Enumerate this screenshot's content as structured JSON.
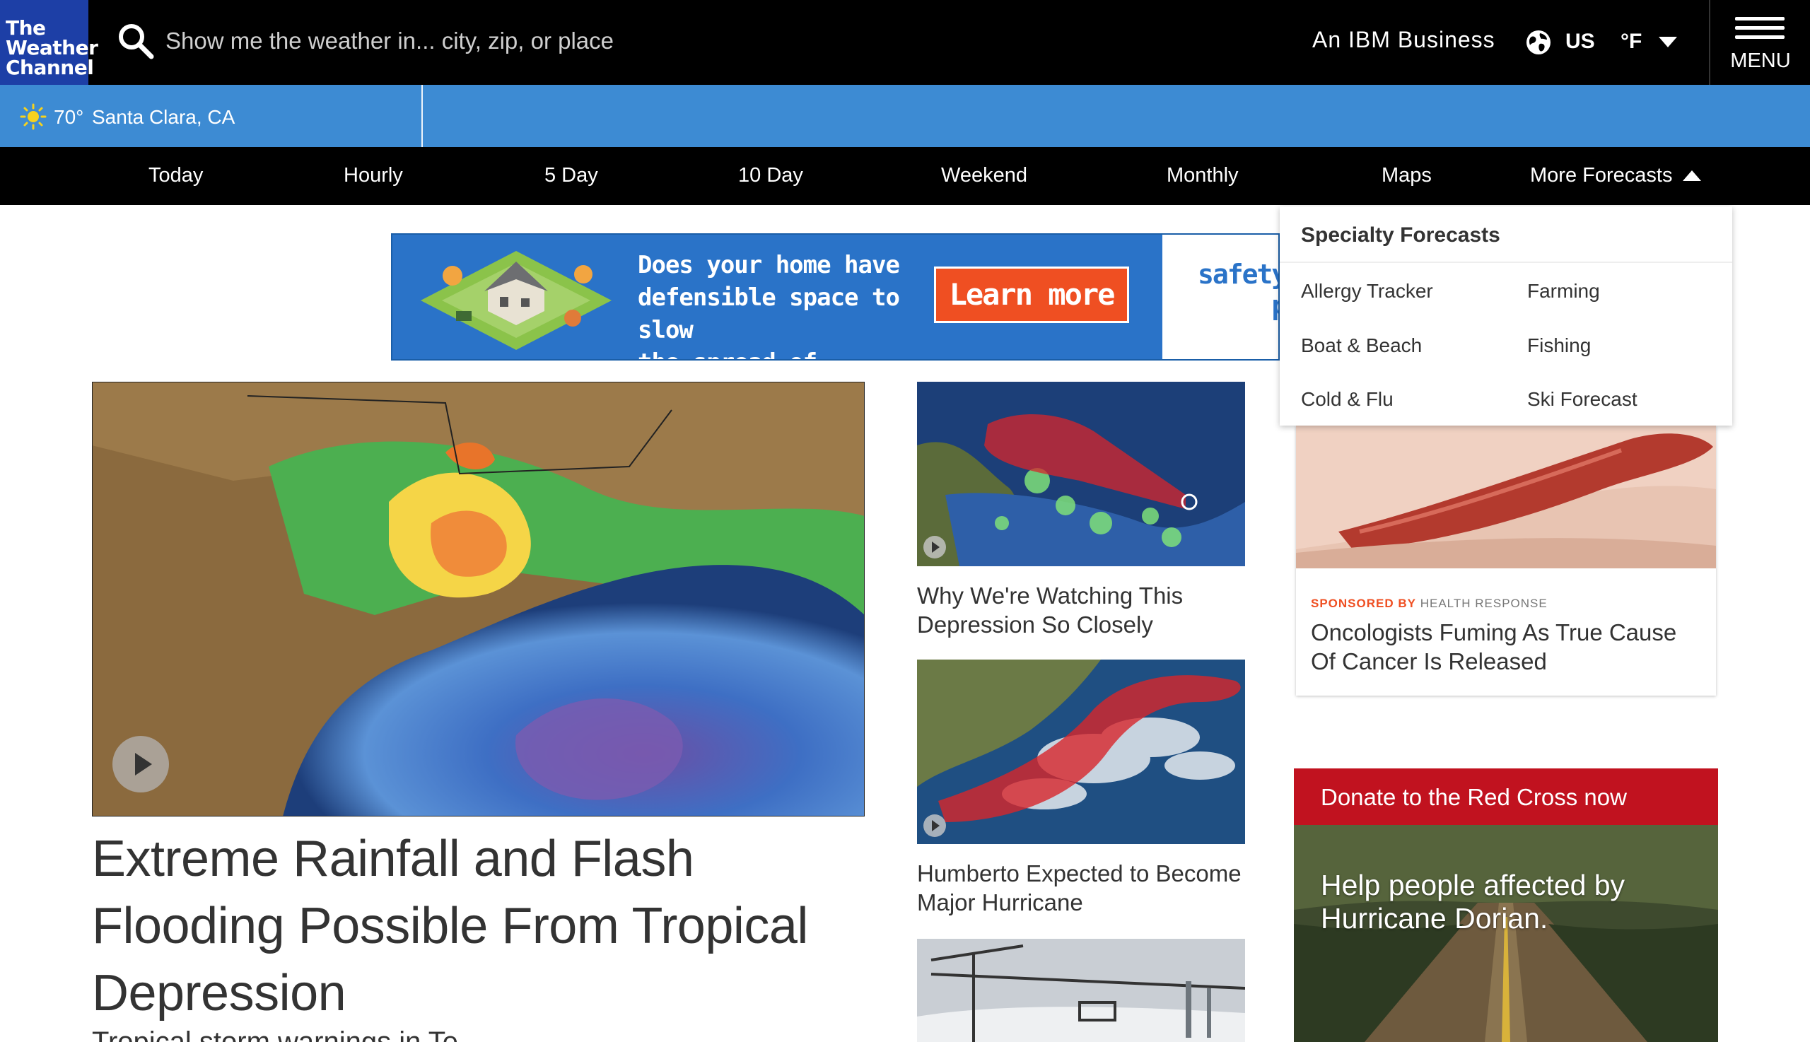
{
  "header": {
    "logo": [
      "The",
      "Weather",
      "Channel"
    ],
    "search_placeholder": "Show me the weather in... city, zip, or place",
    "ibm": "An IBM Business",
    "region": "US",
    "unit": "°F",
    "menu_label": "MENU"
  },
  "location": {
    "icon": "sun-icon",
    "temp": "70°",
    "name": "Santa Clara, CA"
  },
  "nav": {
    "items": [
      "Today",
      "Hourly",
      "5 Day",
      "10 Day",
      "Weekend",
      "Monthly",
      "Maps",
      "More Forecasts"
    ]
  },
  "ad": {
    "headline": [
      "Does your home have",
      "defensible space to slow",
      "the spread of wildfires?"
    ],
    "cta": "Learn more",
    "brand": [
      "safetyac",
      "pge"
    ]
  },
  "hero": {
    "title": "Extreme Rainfall and Flash Flooding Possible From Tropical Depression",
    "subtitle": "Tropical storm warnings in Te"
  },
  "cards": [
    {
      "title": "Why We're Watching This Depression So Closely"
    },
    {
      "title": "Humberto Expected to Become Major Hurricane"
    }
  ],
  "dropdown": {
    "title": "Specialty Forecasts",
    "items": [
      "Allergy Tracker",
      "Farming",
      "Boat & Beach",
      "Fishing",
      "Cold & Flu",
      "Ski Forecast"
    ]
  },
  "sponsored": {
    "lead": "SPONSORED BY",
    "source": "HEALTH RESPONSE",
    "title": "Oncologists Fuming As True Cause Of Cancer Is Released"
  },
  "donate": {
    "label": "Donate to the Red Cross now",
    "text": "Help people affected by Hurricane Dorian."
  },
  "colors": {
    "header_bg": "#000000",
    "logo_bg": "#1d3fa6",
    "location_bar": "#3d8bd3",
    "ad_cta": "#ef4f22",
    "donate_bar": "#c1121f"
  }
}
